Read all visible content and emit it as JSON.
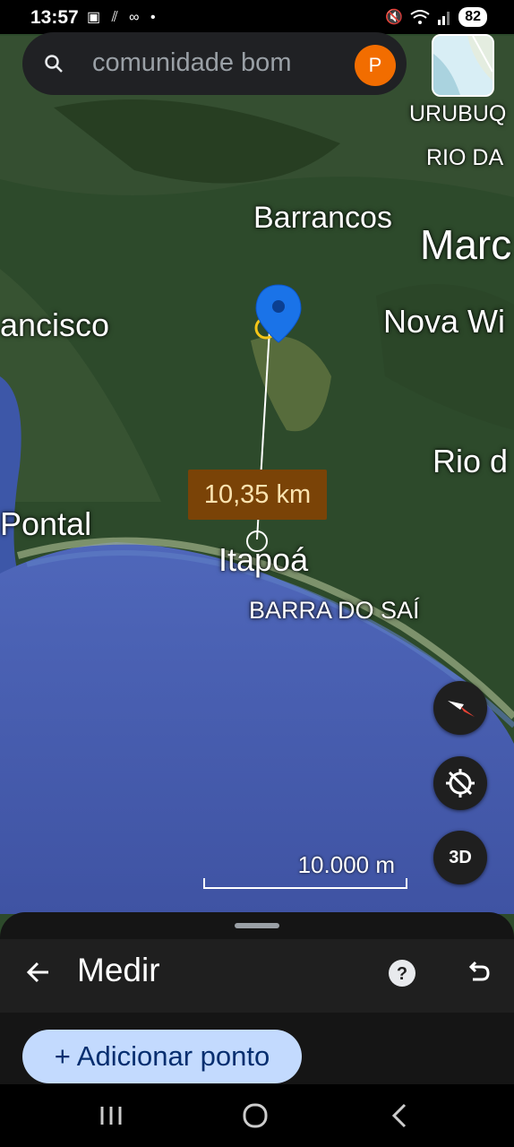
{
  "status_bar": {
    "time": "13:57",
    "battery": "82"
  },
  "search": {
    "query": "comunidade bom",
    "avatar_letter": "P"
  },
  "map": {
    "place_labels": [
      {
        "name": "URUBUQ"
      },
      {
        "name": "RIO DA"
      },
      {
        "name": "Barrancos"
      },
      {
        "name": "Marc"
      },
      {
        "name": "ancisco"
      },
      {
        "name": "Nova Wi"
      },
      {
        "name": "Rio d"
      },
      {
        "name": "Pontal"
      },
      {
        "name": "Itapoá"
      },
      {
        "name": "BARRA DO SAÍ"
      }
    ],
    "measure_distance": "10,35 km",
    "scale_label": "10.000 m",
    "button_3d": "3D",
    "colors": {
      "ocean": "#4a5fb0",
      "forest": "#2e4d2c",
      "pin": "#1a73e8",
      "distance_badge": "#7a4307"
    }
  },
  "bottom_sheet": {
    "title": "Medir",
    "add_point_label": "+ Adicionar ponto"
  }
}
